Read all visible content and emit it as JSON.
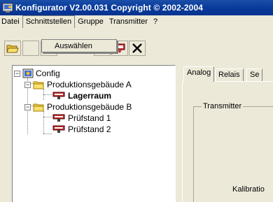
{
  "window": {
    "title": "Konfigurator  V2.00.031 Copyright © 2002-2004"
  },
  "menu": {
    "items": [
      "Datei",
      "Schnittstellen",
      "Gruppe",
      "Transmitter",
      "?"
    ],
    "active_index": 1,
    "dropdown": {
      "items": [
        "Auswählen"
      ]
    }
  },
  "toolbar": {
    "buttons": [
      "open-folder-icon",
      "unknown-icon",
      "unknown-icon",
      "flag-green-icon",
      "flag-red-icon",
      "delete-x-icon"
    ]
  },
  "tree": {
    "root": "Config",
    "groups": [
      {
        "label": "Produktionsgebäude A",
        "children": [
          {
            "label": "Lagerraum",
            "selected": true
          }
        ]
      },
      {
        "label": "Produktionsgebäude B",
        "children": [
          {
            "label": "Prüfstand 1",
            "selected": false
          },
          {
            "label": "Prüfstand 2",
            "selected": false
          }
        ]
      }
    ]
  },
  "details": {
    "tabs": [
      "Analog",
      "Relais",
      "Se"
    ],
    "active_tab": 0,
    "group_title": "Transmitter",
    "kalibration_label": "Kalibratio"
  },
  "colors": {
    "titlebar": "#0A3C9C",
    "window_bg": "#ECE9D8",
    "tree_bg": "#FFFFFF"
  }
}
